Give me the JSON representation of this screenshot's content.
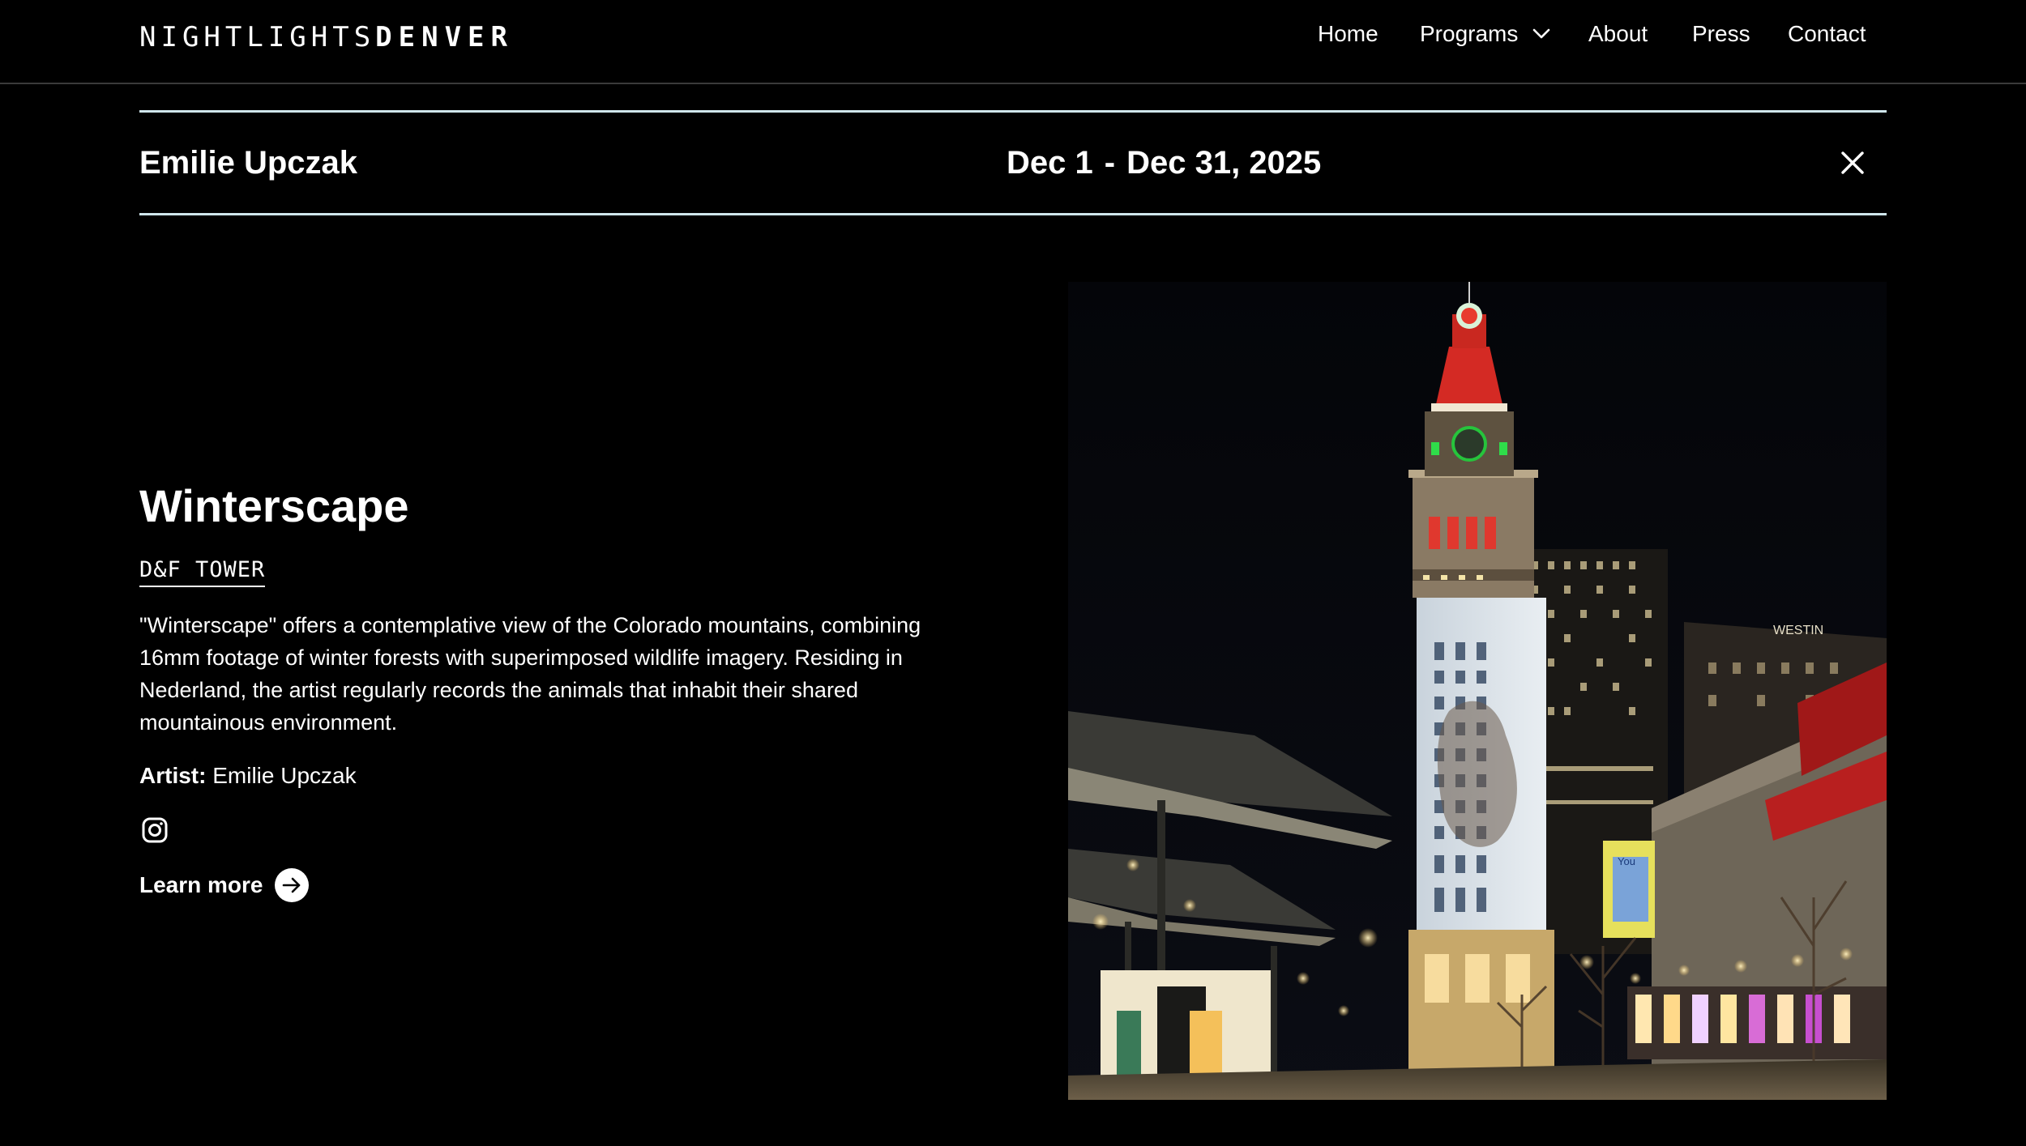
{
  "brand": {
    "logo_light": "NIGHTLIGHTS",
    "logo_bold": "DENVER"
  },
  "nav": {
    "home": "Home",
    "programs": "Programs",
    "about": "About",
    "press": "Press",
    "contact": "Contact"
  },
  "event": {
    "artist_name": "Emilie Upczak",
    "date_start": "Dec 1",
    "date_separator": "-",
    "date_end": "Dec 31, 2025"
  },
  "artwork": {
    "title": "Winterscape",
    "location": "D&F TOWER",
    "description": "\"Winterscape\" offers a contemplative view of the Colorado mountains, combining 16mm footage of winter forests with superimposed wildlife imagery. Residing in Nederland, the artist regularly records the animals that inhabit their shared mountainous environment.",
    "artist_label": "Artist:",
    "artist_value": "Emilie Upczak",
    "learn_more": "Learn more"
  },
  "photo_signage": {
    "hotel_sign": "WESTIN",
    "billboard_text": "You"
  },
  "icons": {
    "close": "close-icon",
    "dropdown": "chevron-down-icon",
    "instagram": "instagram-icon",
    "arrow": "arrow-right-icon"
  },
  "colors": {
    "background": "#000000",
    "divider": "#cfe6ec",
    "text": "#ffffff"
  }
}
